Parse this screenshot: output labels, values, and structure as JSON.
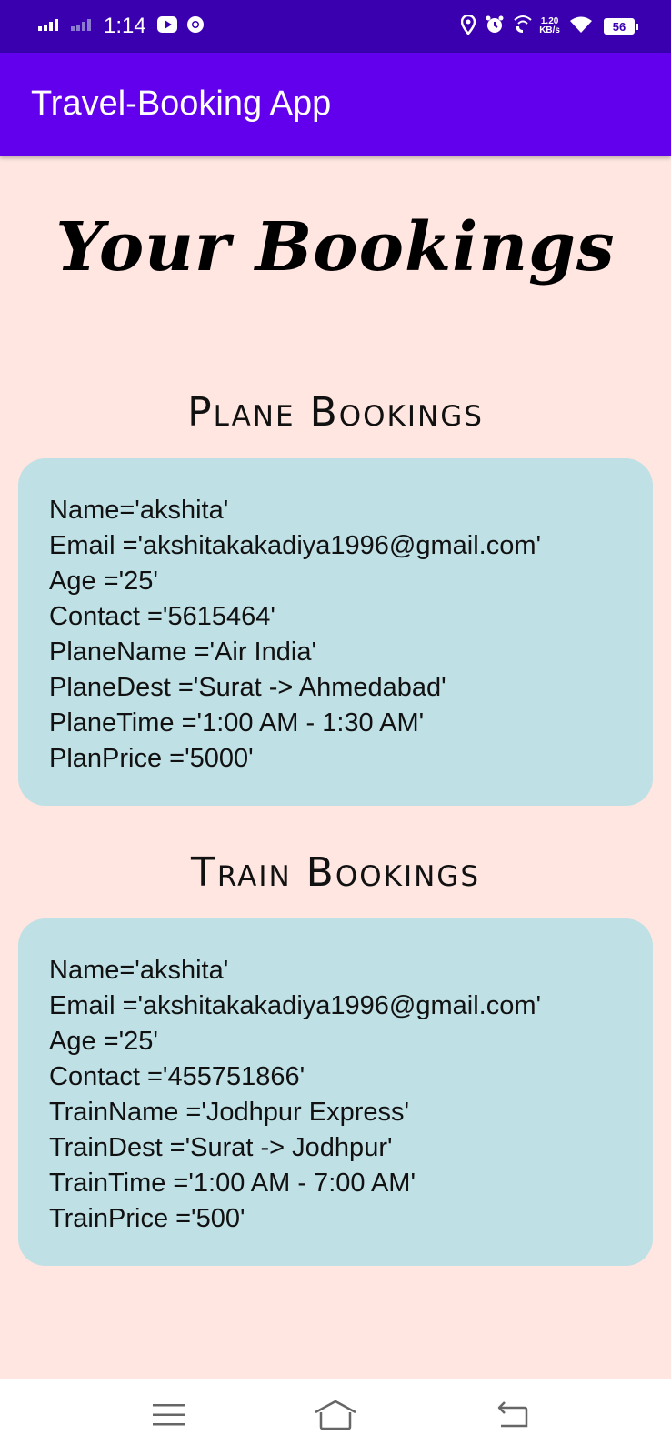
{
  "status_bar": {
    "time": "1:14",
    "net_speed_value": "1.20",
    "net_speed_unit": "KB/s",
    "battery": "56",
    "icons": [
      "signal-icon",
      "signal-weak-icon",
      "youtube-icon",
      "chrome-icon",
      "location-icon",
      "alarm-icon",
      "wifi-calling-icon",
      "wifi-icon",
      "battery-icon"
    ]
  },
  "app_bar": {
    "title": "Travel-Booking App"
  },
  "page": {
    "title": "Your Bookings"
  },
  "plane": {
    "section_title": "Plane Bookings",
    "lines": [
      "Name='akshita'",
      "Email ='akshitakakadiya1996@gmail.com'",
      "Age ='25'",
      "Contact ='5615464'",
      "PlaneName ='Air India'",
      "PlaneDest ='Surat -> Ahmedabad'",
      "PlaneTime ='1:00 AM - 1:30 AM'",
      "PlanPrice ='5000'"
    ]
  },
  "train": {
    "section_title": "Train Bookings",
    "lines": [
      "Name='akshita'",
      "Email ='akshitakakadiya1996@gmail.com'",
      "Age ='25'",
      "Contact ='455751866'",
      "TrainName ='Jodhpur Express'",
      "TrainDest ='Surat -> Jodhpur'",
      "TrainTime ='1:00 AM - 7:00 AM'",
      "TrainPrice ='500'"
    ]
  },
  "nav_bar": {
    "icons": [
      "menu-icon",
      "home-icon",
      "back-icon"
    ]
  },
  "colors": {
    "status_bar": "#3a00b0",
    "app_bar": "#6200ee",
    "background": "#ffe6e1",
    "card": "#bfe0e5"
  }
}
